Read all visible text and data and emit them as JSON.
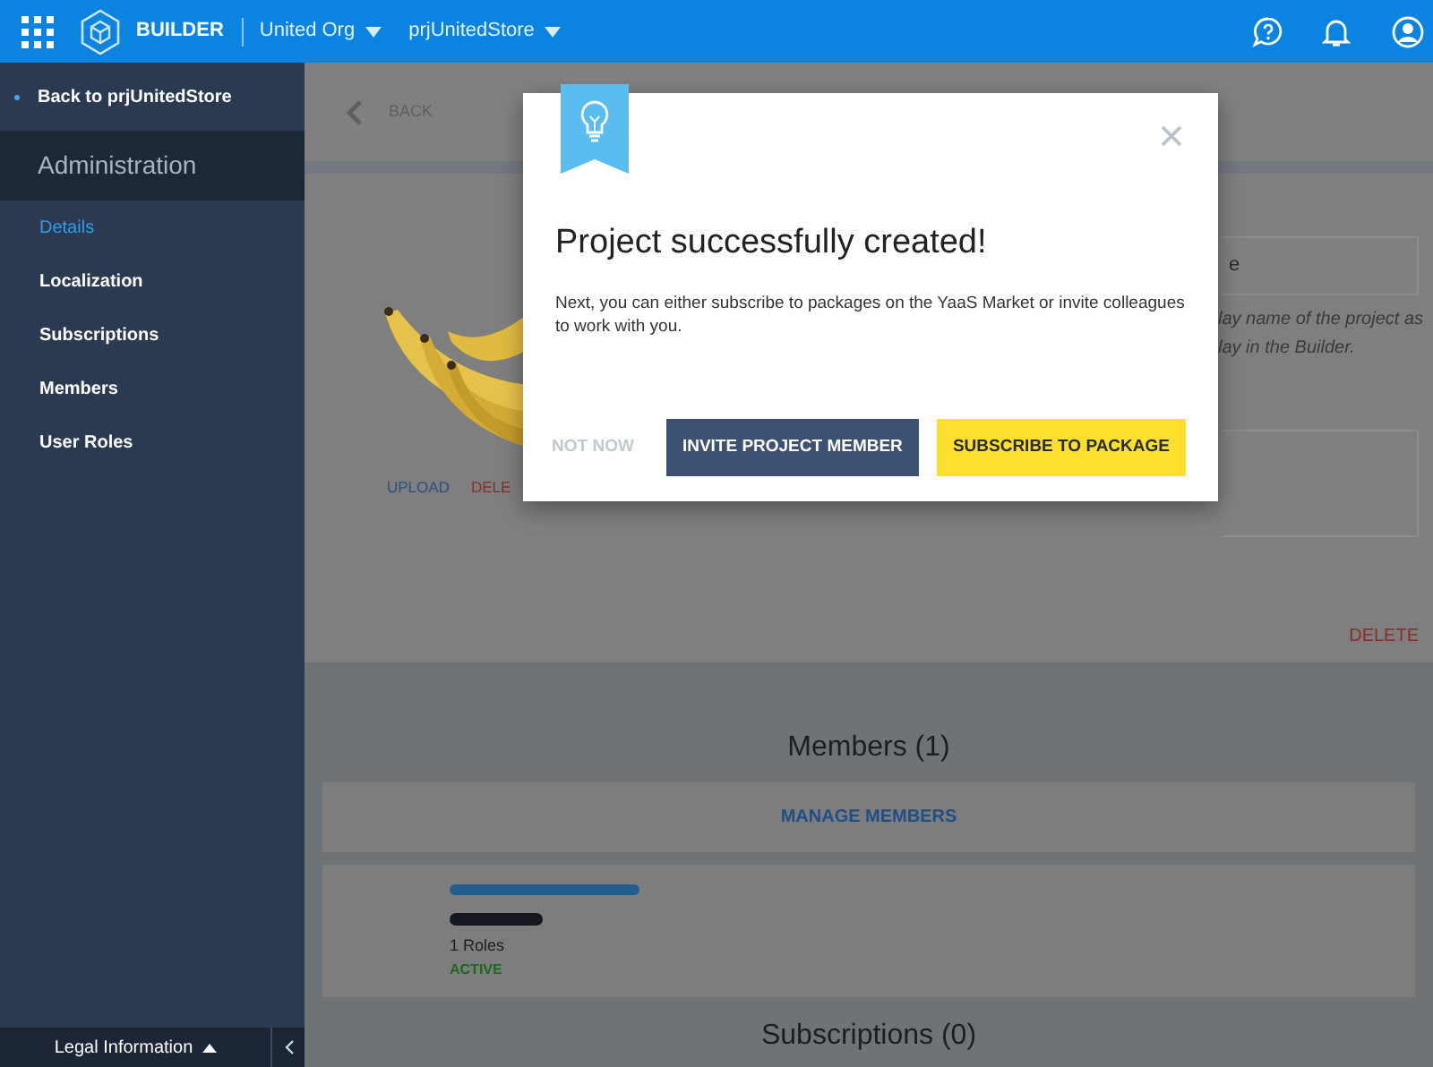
{
  "topbar": {
    "brand": "BUILDER",
    "org": "United Org",
    "project": "prjUnitedStore"
  },
  "sidebar": {
    "back": "Back to prjUnitedStore",
    "section": "Administration",
    "items": [
      {
        "label": "Details",
        "selected": true
      },
      {
        "label": "Localization",
        "selected": false
      },
      {
        "label": "Subscriptions",
        "selected": false
      },
      {
        "label": "Members",
        "selected": false
      },
      {
        "label": "User Roles",
        "selected": false
      }
    ],
    "footer": "Legal Information"
  },
  "page": {
    "back": "BACK",
    "image_actions": [
      "UPLOAD",
      "DELE"
    ],
    "name_field_value": "e",
    "helper_lines": [
      "lay name of the project as",
      "lay in the Builder."
    ],
    "delete": "DELETE",
    "members": {
      "heading": "Members (1)",
      "manage": "MANAGE MEMBERS",
      "member": {
        "roles": "1 Roles",
        "status": "ACTIVE"
      }
    },
    "subscriptions_heading": "Subscriptions (0)"
  },
  "dialog": {
    "title": "Project successfully created!",
    "message": "Next, you can either subscribe to packages on the YaaS Market or invite colleagues to work with you.",
    "buttons": [
      {
        "label": "NOT NOW",
        "kind": "text"
      },
      {
        "label": "INVITE PROJECT MEMBER",
        "kind": "secondary"
      },
      {
        "label": "SUBSCRIBE TO PACKAGE",
        "kind": "primary"
      }
    ]
  }
}
